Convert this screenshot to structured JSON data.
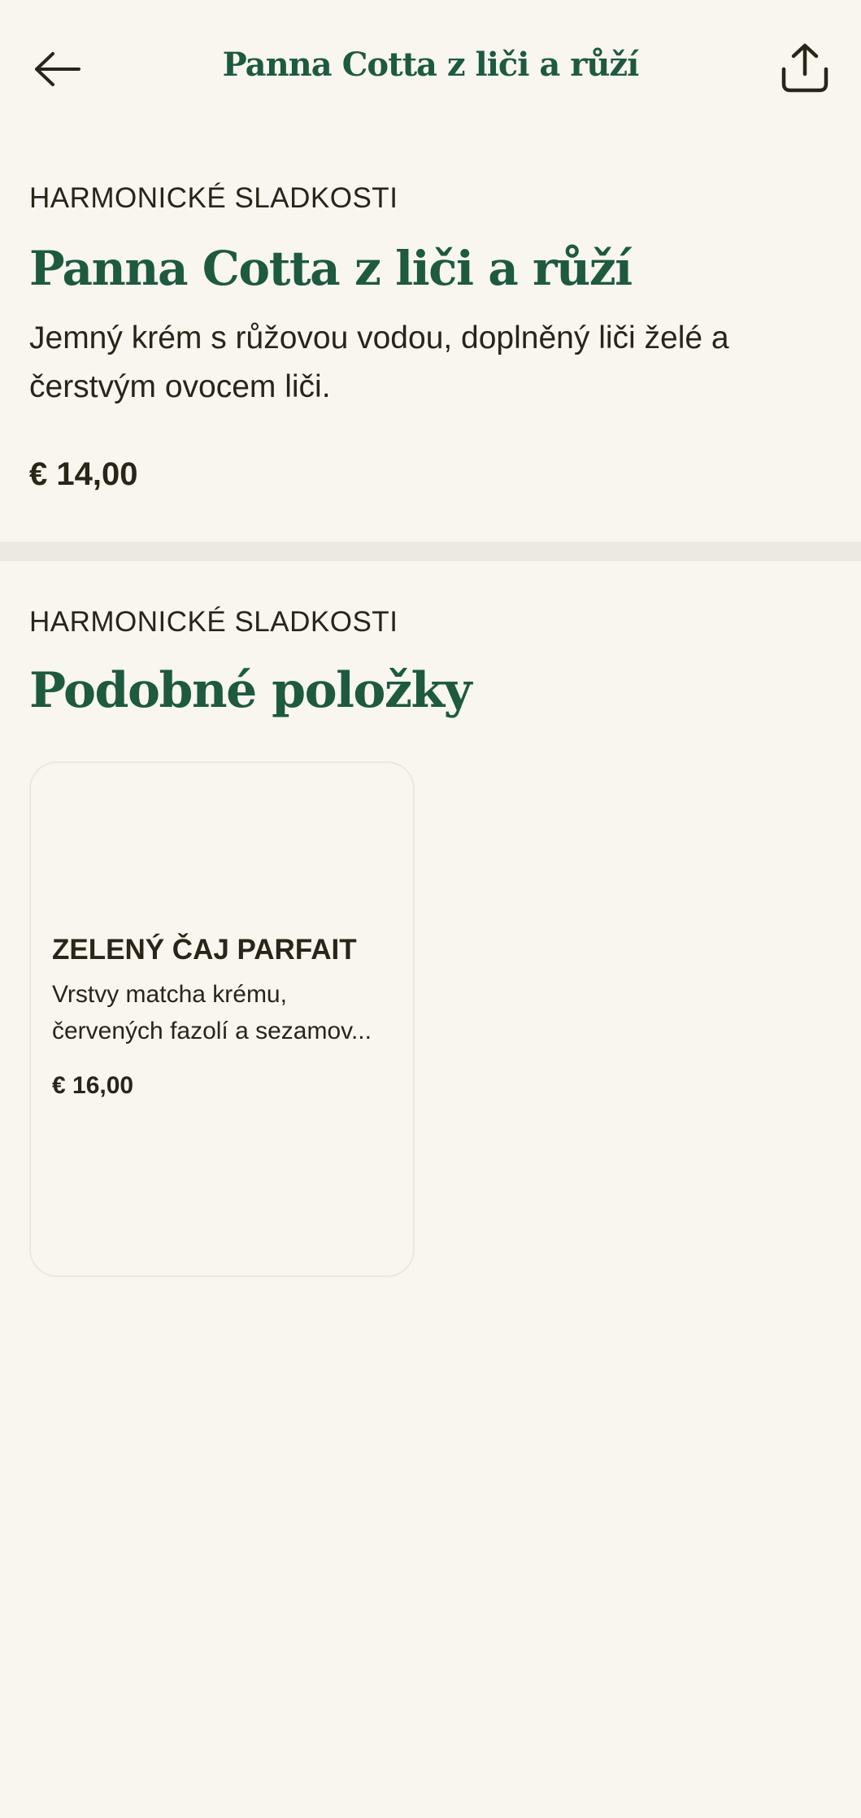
{
  "header": {
    "title": "Panna Cotta z liči a růží",
    "back_icon": "arrow-left-icon",
    "share_icon": "share-icon"
  },
  "item": {
    "category": "HARMONICKÉ SLADKOSTI",
    "title": "Panna Cotta z liči a růží",
    "description": "Jemný krém s růžovou vodou, doplněný liči želé a čerstvým ovocem liči.",
    "price": "€ 14,00"
  },
  "similar": {
    "category": "HARMONICKÉ SLADKOSTI",
    "title": "Podobné položky",
    "items": [
      {
        "title": "ZELENÝ ČAJ PARFAIT",
        "description_line1": "Vrstvy matcha krému,",
        "description_line2": "červených fazolí a sezamov...",
        "price": "€ 16,00"
      }
    ]
  },
  "colors": {
    "background": "#f8f6ef",
    "accent_green": "#1d5a3e",
    "text": "#2a2419",
    "divider": "#ebe9e1"
  }
}
